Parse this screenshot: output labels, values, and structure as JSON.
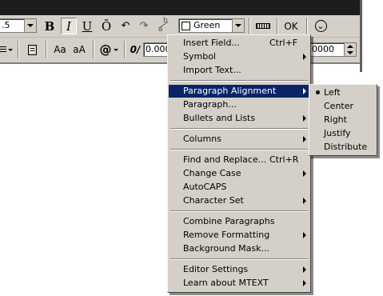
{
  "toolbar1": {
    "font_size_value": ".5",
    "bold_label": "B",
    "italic_label": "I",
    "underline_label": "U",
    "overline_label": "Ō",
    "undo_glyph": "↶",
    "redo_glyph": "↷",
    "stack_glyph_top": "b",
    "stack_glyph_bottom": "a",
    "color_value": "Green",
    "ok_label": "OK",
    "options_glyph": "⌄"
  },
  "toolbar2": {
    "lowercase_label": "Aa",
    "uppercase_label": "aA",
    "symbol_label": "@",
    "oblique_label": "0/",
    "oblique_value": "0.000",
    "width_value": "0000"
  },
  "menu": {
    "groups": [
      {
        "items": [
          {
            "label": "Insert Field...",
            "shortcut": "Ctrl+F",
            "submenu": false
          },
          {
            "label": "Symbol",
            "shortcut": "",
            "submenu": true
          },
          {
            "label": "Import Text...",
            "shortcut": "",
            "submenu": false
          }
        ]
      },
      {
        "items": [
          {
            "label": "Paragraph Alignment",
            "shortcut": "",
            "submenu": true,
            "highlighted": true
          },
          {
            "label": "Paragraph...",
            "shortcut": "",
            "submenu": false
          },
          {
            "label": "Bullets and Lists",
            "shortcut": "",
            "submenu": true
          }
        ]
      },
      {
        "items": [
          {
            "label": "Columns",
            "shortcut": "",
            "submenu": true
          }
        ]
      },
      {
        "items": [
          {
            "label": "Find and Replace...",
            "shortcut": "Ctrl+R",
            "submenu": false
          },
          {
            "label": "Change Case",
            "shortcut": "",
            "submenu": true
          },
          {
            "label": "AutoCAPS",
            "shortcut": "",
            "submenu": false
          },
          {
            "label": "Character Set",
            "shortcut": "",
            "submenu": true
          }
        ]
      },
      {
        "items": [
          {
            "label": "Combine Paragraphs",
            "shortcut": "",
            "submenu": false
          },
          {
            "label": "Remove Formatting",
            "shortcut": "",
            "submenu": true
          },
          {
            "label": "Background Mask...",
            "shortcut": "",
            "submenu": false
          }
        ]
      },
      {
        "items": [
          {
            "label": "Editor Settings",
            "shortcut": "",
            "submenu": true
          },
          {
            "label": "Learn about MTEXT",
            "shortcut": "",
            "submenu": true
          }
        ]
      }
    ]
  },
  "submenu": {
    "items": [
      {
        "label": "Left",
        "checked": true
      },
      {
        "label": "Center",
        "checked": false
      },
      {
        "label": "Right",
        "checked": false
      },
      {
        "label": "Justify",
        "checked": false
      },
      {
        "label": "Distribute",
        "checked": false
      }
    ]
  },
  "colors": {
    "highlight": "#0a246a",
    "face": "#d4d0c8",
    "titlebar": "#1c1c1c",
    "green_swatch": "#00ff00"
  }
}
